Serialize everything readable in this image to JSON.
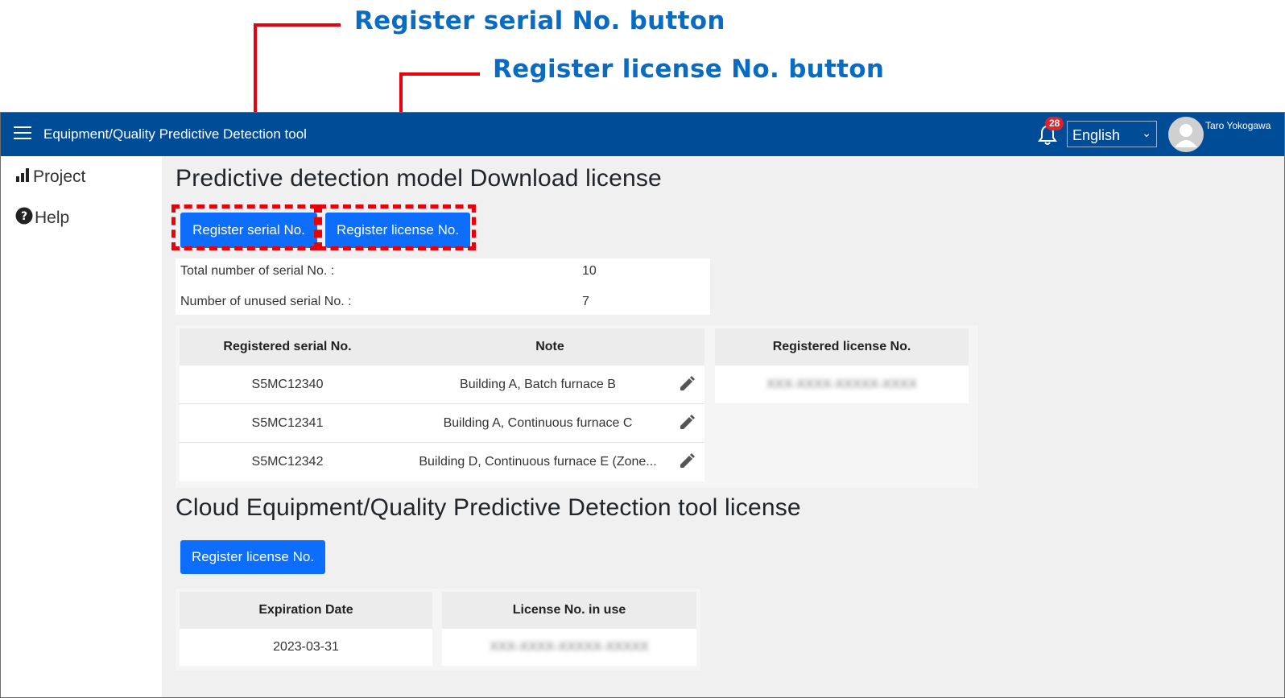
{
  "annotations": {
    "callout_serial": "Register serial No. button",
    "callout_license": "Register license No. button"
  },
  "header": {
    "title": "Equipment/Quality Predictive Detection tool",
    "notification_count": "28",
    "language": "English",
    "user_name": "Taro Yokogawa"
  },
  "sidebar": {
    "items": [
      {
        "label": "Project",
        "icon": "bar-chart-icon"
      },
      {
        "label": "Help",
        "icon": "question-circle-icon"
      }
    ]
  },
  "download_section": {
    "heading": "Predictive detection model Download license",
    "register_serial_label": "Register serial No.",
    "register_license_label": "Register license No.",
    "stats": [
      {
        "label": "Total number of serial No. :",
        "value": "10"
      },
      {
        "label": "Number of unused serial No. :",
        "value": "7"
      }
    ],
    "serial_table": {
      "headers": [
        "Registered serial No.",
        "Note"
      ],
      "rows": [
        {
          "serial": "S5MC12340",
          "note": "Building A, Batch furnace B"
        },
        {
          "serial": "S5MC12341",
          "note": "Building A, Continuous furnace C"
        },
        {
          "serial": "S5MC12342",
          "note": "Building D, Continuous furnace E (Zone..."
        }
      ]
    },
    "license_table": {
      "header": "Registered license No.",
      "rows": [
        "XXX-XXXX-XXXXX-XXXX"
      ]
    }
  },
  "cloud_section": {
    "heading": "Cloud Equipment/Quality Predictive Detection tool license",
    "register_license_label": "Register license No.",
    "table": {
      "headers": [
        "Expiration Date",
        "License No. in use"
      ],
      "rows": [
        {
          "expiration": "2023-03-31",
          "license": "XXX-XXXX-XXXXX-XXXXX"
        }
      ]
    }
  },
  "colors": {
    "topbar": "#004c97",
    "primary_button": "#0d6efd",
    "callout_text": "#0a6bc2",
    "annotation_red": "#e8000b",
    "badge": "#d9262e"
  }
}
